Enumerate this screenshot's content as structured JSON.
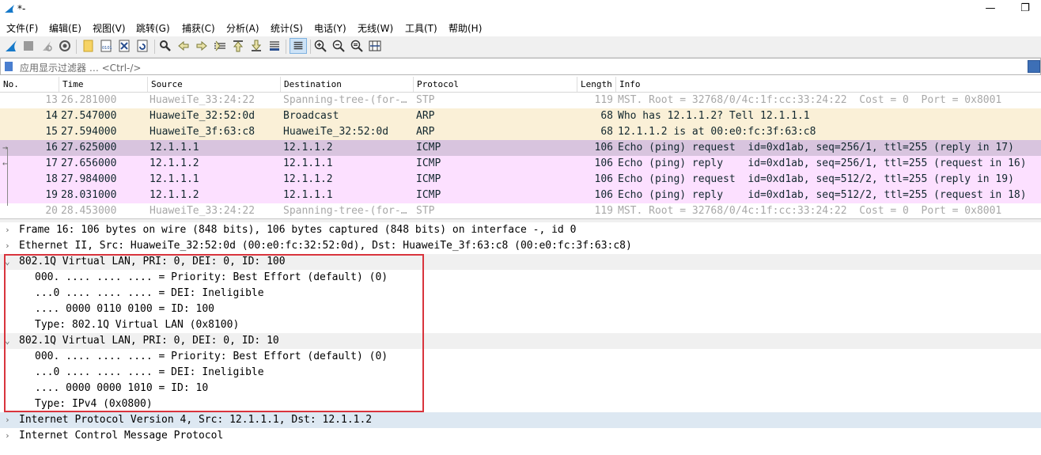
{
  "window": {
    "title": "*-",
    "restore_glyph": "❐",
    "minimize_glyph": "—"
  },
  "menu": [
    "文件(F)",
    "编辑(E)",
    "视图(V)",
    "跳转(G)",
    "捕获(C)",
    "分析(A)",
    "统计(S)",
    "电话(Y)",
    "无线(W)",
    "工具(T)",
    "帮助(H)"
  ],
  "toolbar": {
    "icons": [
      "shark-fin-start-icon",
      "stop-capture-icon",
      "restart-capture-icon",
      "capture-options-icon",
      "open-file-icon",
      "save-file-icon",
      "close-file-icon",
      "reload-file-icon",
      "find-packet-icon",
      "go-back-icon",
      "go-forward-icon",
      "go-to-packet-icon",
      "go-first-icon",
      "go-last-icon",
      "auto-scroll-icon",
      "colorize-icon",
      "zoom-in-icon",
      "zoom-out-icon",
      "zoom-normal-icon",
      "resize-columns-icon"
    ]
  },
  "filter": {
    "placeholder": "应用显示过滤器 … <Ctrl-/>"
  },
  "columns": {
    "no": "No.",
    "time": "Time",
    "source": "Source",
    "destination": "Destination",
    "protocol": "Protocol",
    "length": "Length",
    "info": "Info"
  },
  "packets": [
    {
      "no": "13",
      "time": "26.281000",
      "source": "HuaweiTe_33:24:22",
      "destination": "Spanning-tree-(for-…",
      "protocol": "STP",
      "length": "119",
      "info": "MST. Root = 32768/0/4c:1f:cc:33:24:22  Cost = 0  Port = 0x8001",
      "bg": "#ffffff",
      "fg": "#a8a8a8",
      "arrow": ""
    },
    {
      "no": "14",
      "time": "27.547000",
      "source": "HuaweiTe_32:52:0d",
      "destination": "Broadcast",
      "protocol": "ARP",
      "length": "68",
      "info": "Who has 12.1.1.2? Tell 12.1.1.1",
      "bg": "#faf0d7",
      "fg": "#12272e",
      "arrow": ""
    },
    {
      "no": "15",
      "time": "27.594000",
      "source": "HuaweiTe_3f:63:c8",
      "destination": "HuaweiTe_32:52:0d",
      "protocol": "ARP",
      "length": "68",
      "info": "12.1.1.2 is at 00:e0:fc:3f:63:c8",
      "bg": "#faf0d7",
      "fg": "#12272e",
      "arrow": ""
    },
    {
      "no": "16",
      "time": "27.625000",
      "source": "12.1.1.1",
      "destination": "12.1.1.2",
      "protocol": "ICMP",
      "length": "106",
      "info": "Echo (ping) request  id=0xd1ab, seq=256/1, ttl=255 (reply in 17)",
      "bg": "#d8c4de",
      "fg": "#12272e",
      "arrow": "→"
    },
    {
      "no": "17",
      "time": "27.656000",
      "source": "12.1.1.2",
      "destination": "12.1.1.1",
      "protocol": "ICMP",
      "length": "106",
      "info": "Echo (ping) reply    id=0xd1ab, seq=256/1, ttl=255 (request in 16)",
      "bg": "#fce0ff",
      "fg": "#12272e",
      "arrow": "←"
    },
    {
      "no": "18",
      "time": "27.984000",
      "source": "12.1.1.1",
      "destination": "12.1.1.2",
      "protocol": "ICMP",
      "length": "106",
      "info": "Echo (ping) request  id=0xd1ab, seq=512/2, ttl=255 (reply in 19)",
      "bg": "#fce0ff",
      "fg": "#12272e",
      "arrow": ""
    },
    {
      "no": "19",
      "time": "28.031000",
      "source": "12.1.1.2",
      "destination": "12.1.1.1",
      "protocol": "ICMP",
      "length": "106",
      "info": "Echo (ping) reply    id=0xd1ab, seq=512/2, ttl=255 (request in 18)",
      "bg": "#fce0ff",
      "fg": "#12272e",
      "arrow": ""
    },
    {
      "no": "20",
      "time": "28.453000",
      "source": "HuaweiTe_33:24:22",
      "destination": "Spanning-tree-(for-…",
      "protocol": "STP",
      "length": "119",
      "info": "MST. Root = 32768/0/4c:1f:cc:33:24:22  Cost = 0  Port = 0x8001",
      "bg": "#ffffff",
      "fg": "#a8a8a8",
      "arrow": ""
    }
  ],
  "details": [
    {
      "text": "Frame 16: 106 bytes on wire (848 bits), 106 bytes captured (848 bits) on interface -, id 0",
      "level": 0,
      "twist": "›",
      "bg": "#ffffff"
    },
    {
      "text": "Ethernet II, Src: HuaweiTe_32:52:0d (00:e0:fc:32:52:0d), Dst: HuaweiTe_3f:63:c8 (00:e0:fc:3f:63:c8)",
      "level": 0,
      "twist": "›",
      "bg": "#ffffff"
    },
    {
      "text": "802.1Q Virtual LAN, PRI: 0, DEI: 0, ID: 100",
      "level": 0,
      "twist": "⌄",
      "bg": "#f0f0f0"
    },
    {
      "text": "000. .... .... .... = Priority: Best Effort (default) (0)",
      "level": 1,
      "twist": "",
      "bg": "#ffffff"
    },
    {
      "text": "...0 .... .... .... = DEI: Ineligible",
      "level": 1,
      "twist": "",
      "bg": "#ffffff"
    },
    {
      "text": ".... 0000 0110 0100 = ID: 100",
      "level": 1,
      "twist": "",
      "bg": "#ffffff"
    },
    {
      "text": "Type: 802.1Q Virtual LAN (0x8100)",
      "level": 1,
      "twist": "",
      "bg": "#ffffff"
    },
    {
      "text": "802.1Q Virtual LAN, PRI: 0, DEI: 0, ID: 10",
      "level": 0,
      "twist": "⌄",
      "bg": "#f0f0f0"
    },
    {
      "text": "000. .... .... .... = Priority: Best Effort (default) (0)",
      "level": 1,
      "twist": "",
      "bg": "#ffffff"
    },
    {
      "text": "...0 .... .... .... = DEI: Ineligible",
      "level": 1,
      "twist": "",
      "bg": "#ffffff"
    },
    {
      "text": ".... 0000 0000 1010 = ID: 10",
      "level": 1,
      "twist": "",
      "bg": "#ffffff"
    },
    {
      "text": "Type: IPv4 (0x0800)",
      "level": 1,
      "twist": "",
      "bg": "#ffffff"
    },
    {
      "text": "Internet Protocol Version 4, Src: 12.1.1.1, Dst: 12.1.1.2",
      "level": 0,
      "twist": "›",
      "bg": "#dde8f2"
    },
    {
      "text": "Internet Control Message Protocol",
      "level": 0,
      "twist": "›",
      "bg": "#ffffff"
    }
  ],
  "colors": {
    "highlight_border": "#d9343d",
    "accent": "#3d6fb6"
  }
}
